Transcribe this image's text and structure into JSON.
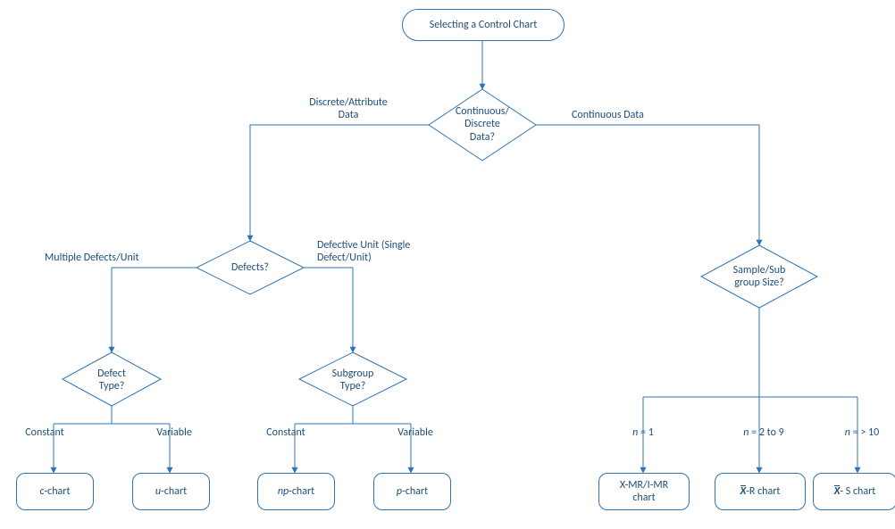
{
  "start": {
    "label": "Selecting a Control Chart"
  },
  "decisions": {
    "dataType": {
      "label": "Continuous/\nDiscrete\nData?"
    },
    "defects": {
      "label": "Defects?"
    },
    "sampleSize": {
      "label": "Sample/Sub\ngroup Size?"
    },
    "defectType": {
      "label": "Defect\nType?"
    },
    "subgroupType": {
      "label": "Subgroup\nType?"
    }
  },
  "edgeLabels": {
    "discreteAttr": "Discrete/Attribute\nData",
    "continuous": "Continuous Data",
    "multipleDefects": "Multiple Defects/Unit",
    "defectiveUnit": "Defective Unit (Single\nDefect/Unit)",
    "constant1": "Constant",
    "variable1": "Variable",
    "constant2": "Constant",
    "variable2": "Variable",
    "n1": "n = 1",
    "n2to9": "n = 2 to 9",
    "nGe10": "n = > 10"
  },
  "terminals": {
    "cChart": "c-chart",
    "uChart": "u-chart",
    "npChart": "np-chart",
    "pChart": "p-chart",
    "xmr": "X-MR/I-MR\nchart",
    "xbarR": "X-R chart",
    "xbarS": "X- S chart"
  },
  "chart_data": {
    "type": "flowchart",
    "title": "Selecting a Control Chart",
    "nodes": [
      {
        "id": "start",
        "type": "terminator",
        "label": "Selecting a Control Chart"
      },
      {
        "id": "dataType",
        "type": "decision",
        "label": "Continuous/ Discrete Data?"
      },
      {
        "id": "defects",
        "type": "decision",
        "label": "Defects?"
      },
      {
        "id": "sampleSize",
        "type": "decision",
        "label": "Sample/Sub group Size?"
      },
      {
        "id": "defectType",
        "type": "decision",
        "label": "Defect Type?"
      },
      {
        "id": "subgroupType",
        "type": "decision",
        "label": "Subgroup Type?"
      },
      {
        "id": "cChart",
        "type": "result",
        "label": "c-chart"
      },
      {
        "id": "uChart",
        "type": "result",
        "label": "u-chart"
      },
      {
        "id": "npChart",
        "type": "result",
        "label": "np-chart"
      },
      {
        "id": "pChart",
        "type": "result",
        "label": "p-chart"
      },
      {
        "id": "xmr",
        "type": "result",
        "label": "X-MR/I-MR chart"
      },
      {
        "id": "xbarR",
        "type": "result",
        "label": "X̄-R chart"
      },
      {
        "id": "xbarS",
        "type": "result",
        "label": "X̄-S chart"
      }
    ],
    "edges": [
      {
        "from": "start",
        "to": "dataType",
        "label": ""
      },
      {
        "from": "dataType",
        "to": "defects",
        "label": "Discrete/Attribute Data"
      },
      {
        "from": "dataType",
        "to": "sampleSize",
        "label": "Continuous Data"
      },
      {
        "from": "defects",
        "to": "defectType",
        "label": "Multiple Defects/Unit"
      },
      {
        "from": "defects",
        "to": "subgroupType",
        "label": "Defective Unit (Single Defect/Unit)"
      },
      {
        "from": "defectType",
        "to": "cChart",
        "label": "Constant"
      },
      {
        "from": "defectType",
        "to": "uChart",
        "label": "Variable"
      },
      {
        "from": "subgroupType",
        "to": "npChart",
        "label": "Constant"
      },
      {
        "from": "subgroupType",
        "to": "pChart",
        "label": "Variable"
      },
      {
        "from": "sampleSize",
        "to": "xmr",
        "label": "n = 1"
      },
      {
        "from": "sampleSize",
        "to": "xbarR",
        "label": "n = 2 to 9"
      },
      {
        "from": "sampleSize",
        "to": "xbarS",
        "label": "n = > 10"
      }
    ]
  }
}
